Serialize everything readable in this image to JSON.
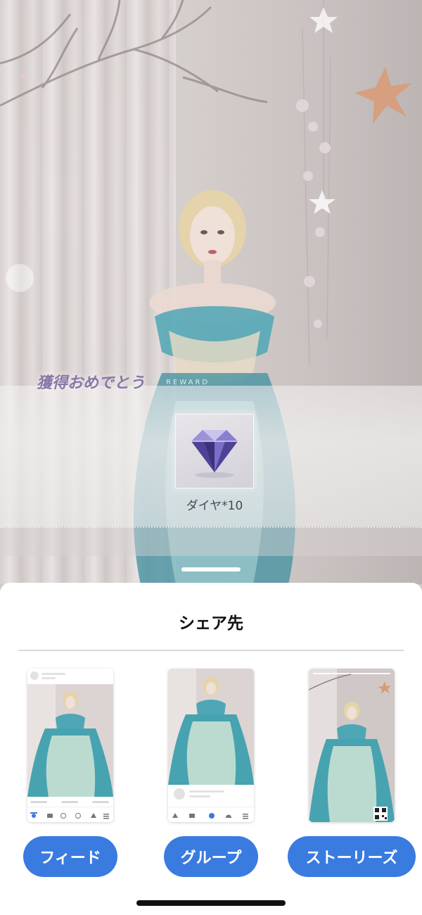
{
  "reward": {
    "congrats_text": "獲得おめでとう",
    "congrats_sub": "REWARD",
    "item_label": "ダイヤ*10",
    "item_icon": "diamond-icon"
  },
  "share_sheet": {
    "title": "シェア先",
    "options": [
      {
        "label": "フィード",
        "preview": "feed-preview"
      },
      {
        "label": "グループ",
        "preview": "group-preview"
      },
      {
        "label": "ストーリーズ",
        "preview": "stories-preview"
      }
    ]
  },
  "colors": {
    "accent": "#3a7be0",
    "congrats": "#8877a8",
    "sheet_bg": "#ffffff"
  }
}
